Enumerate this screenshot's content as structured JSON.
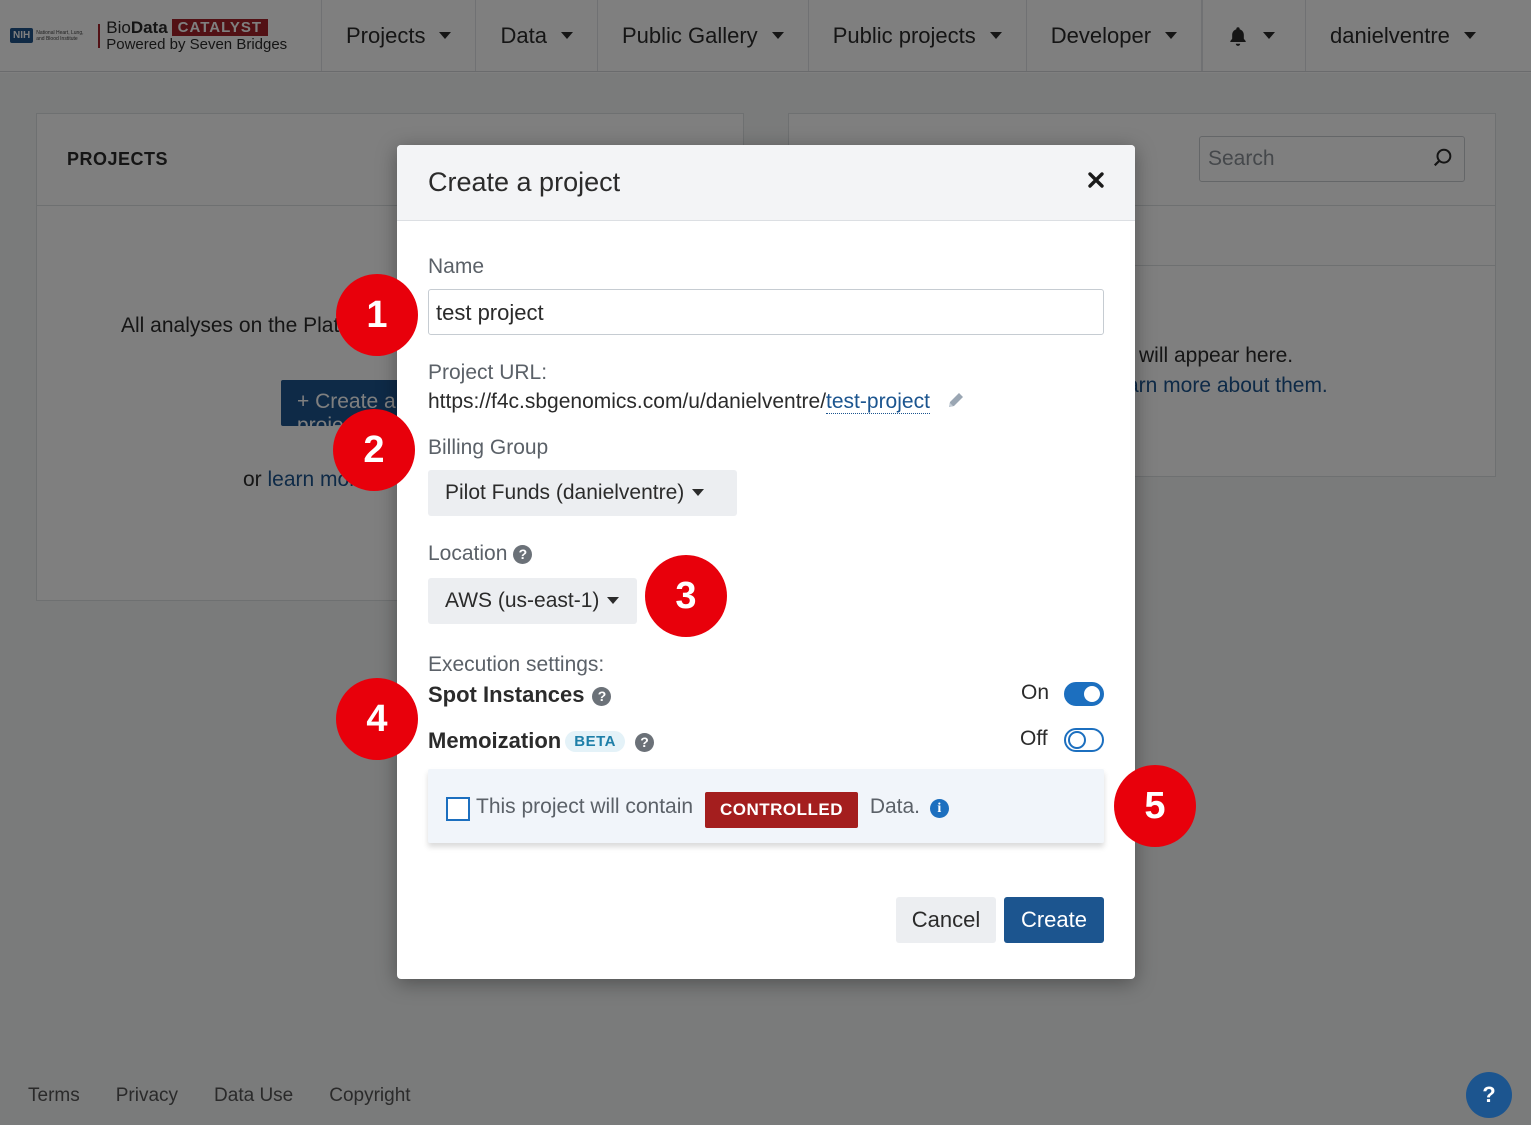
{
  "brand": {
    "nih_tag": "NIH",
    "nih_sub": "National Heart, Lung, and Blood Institute",
    "bio_a": "Bio",
    "bio_b": "Data",
    "catalyst": "CATALYST",
    "powered": "Powered by Seven Bridges"
  },
  "nav": {
    "projects": "Projects",
    "data": "Data",
    "gallery": "Public Gallery",
    "public_projects": "Public projects",
    "developer": "Developer",
    "user": "danielventre"
  },
  "background": {
    "projects_header": "PROJECTS",
    "projects_lead": "All analyses on the Platform are organized into projects.",
    "create_btn": "+ Create a project",
    "or_text": "or ",
    "learn_more": "learn more.",
    "search_placeholder": "Search",
    "right_line1": "will appear here.",
    "right_line2": "arn more about them."
  },
  "footer": {
    "terms": "Terms",
    "privacy": "Privacy",
    "data_use": "Data Use",
    "copyright": "Copyright",
    "help": "?"
  },
  "modal": {
    "title": "Create a project",
    "name_label": "Name",
    "name_value": "test project",
    "url_label": "Project URL:",
    "url_base": "https://f4c.sbgenomics.com/u/danielventre/",
    "url_slug": "test-project",
    "billing_label": "Billing Group",
    "billing_value": "Pilot Funds (danielventre)",
    "location_label": "Location",
    "location_value": "AWS (us-east-1)",
    "exec_label": "Execution settings:",
    "spot_label": "Spot Instances",
    "spot_state": "On",
    "memo_label": "Memoization",
    "memo_badge": "BETA",
    "memo_state": "Off",
    "controlled_pre": "This project will contain",
    "controlled_badge": "CONTROLLED",
    "controlled_post": "Data.",
    "cancel": "Cancel",
    "create": "Create"
  },
  "markers": [
    "1",
    "2",
    "3",
    "4",
    "5"
  ],
  "colors": {
    "primary": "#1c558f",
    "toggle": "#1c6fbf",
    "controlled": "#a41e1e",
    "catalyst": "#a5232b",
    "marker": "#e8000b"
  }
}
